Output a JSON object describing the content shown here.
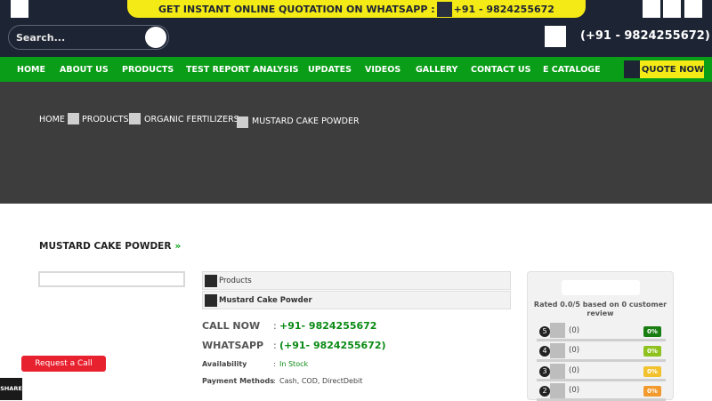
{
  "header": {
    "whatsapp_banner_text": "GET INSTANT ONLINE QUOTATION ON WHATSAPP :",
    "whatsapp_banner_number": "+91 - 9824255672",
    "search_placeholder": "Search...",
    "phone": "(+91 - 9824255672)"
  },
  "nav": {
    "items": [
      "HOME",
      "ABOUT US",
      "PRODUCTS",
      "TEST REPORT ANALYSIS",
      "UPDATES",
      "VIDEOS",
      "GALLERY",
      "CONTACT US",
      "E CATALOGE"
    ],
    "quote_label": "QUOTE NOW"
  },
  "breadcrumb": [
    "HOME",
    "PRODUCTS",
    "ORGANIC FERTILIZERS",
    "MUSTARD CAKE POWDER"
  ],
  "product": {
    "heading": "MUSTARD CAKE POWDER",
    "heading_arrow": "»",
    "category_tag": "Products",
    "name_tag": "Mustard Cake Powder",
    "call_label": "CALL NOW",
    "call_value": "+91- 9824255672",
    "whatsapp_label": "WHATSAPP",
    "whatsapp_value": "(+91- 9824255672)",
    "availability_label": "Availability",
    "availability_value": "In Stock",
    "payment_label": "Payment Methods",
    "payment_value": "Cash, COD, DirectDebit",
    "colon": ":"
  },
  "rating": {
    "summary": "Rated 0.0/5 based on 0 customer review",
    "rows": [
      {
        "star": "5",
        "count": "(0)",
        "percent": "0%",
        "color": "#1a7d12"
      },
      {
        "star": "4",
        "count": "(0)",
        "percent": "0%",
        "color": "#8fc21f"
      },
      {
        "star": "3",
        "count": "(0)",
        "percent": "0%",
        "color": "#f2c12e"
      },
      {
        "star": "2",
        "count": "(0)",
        "percent": "0%",
        "color": "#f29a2e"
      }
    ]
  },
  "widgets": {
    "request_call": "Request a Call",
    "share": "SHARE"
  },
  "colors": {
    "header_bg": "#1d2433",
    "nav_green": "#0a9e18",
    "banner_yellow": "#f4ea16",
    "hero_bg": "#3d3d3d",
    "accent_red": "#e8212f"
  }
}
